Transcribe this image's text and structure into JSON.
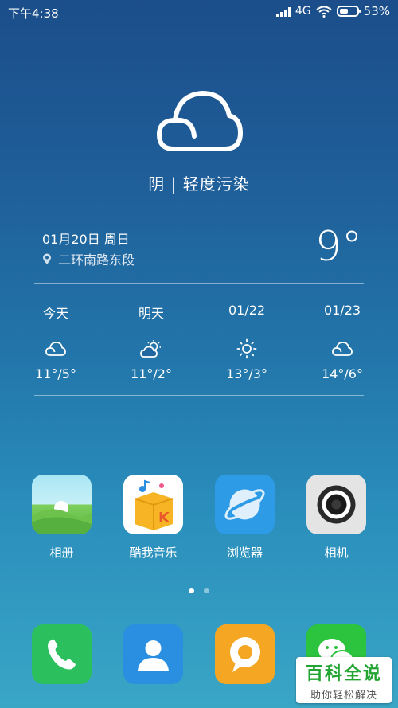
{
  "status_bar": {
    "time": "下午4:38",
    "network": "4G",
    "battery_percent": "53%",
    "battery_level": 0.53
  },
  "weather": {
    "condition": "阴 | 轻度污染",
    "date": "01月20日 周日",
    "location": "二环南路东段",
    "current_temp": "9°",
    "forecast": [
      {
        "label": "今天",
        "icon": "cloud-icon",
        "temps": "11°/5°"
      },
      {
        "label": "明天",
        "icon": "partly-sunny-icon",
        "temps": "11°/2°"
      },
      {
        "label": "01/22",
        "icon": "sun-icon",
        "temps": "13°/3°"
      },
      {
        "label": "01/23",
        "icon": "cloud-icon",
        "temps": "14°/6°"
      }
    ]
  },
  "apps": [
    {
      "name": "相册",
      "icon": "gallery-icon"
    },
    {
      "name": "酷我音乐",
      "icon": "kuwo-music-icon"
    },
    {
      "name": "浏览器",
      "icon": "browser-icon"
    },
    {
      "name": "相机",
      "icon": "camera-icon"
    }
  ],
  "dock": [
    {
      "icon": "phone-icon",
      "color": "#2bbf5e"
    },
    {
      "icon": "contacts-icon",
      "color": "#2a8fe0"
    },
    {
      "icon": "messages-icon",
      "color": "#f5a623"
    },
    {
      "icon": "wechat-icon",
      "color": "#2cc33f"
    }
  ],
  "pager": {
    "current": 1,
    "total": 2
  },
  "watermark": {
    "title": "百科全说",
    "subtitle": "助你轻松解决"
  }
}
